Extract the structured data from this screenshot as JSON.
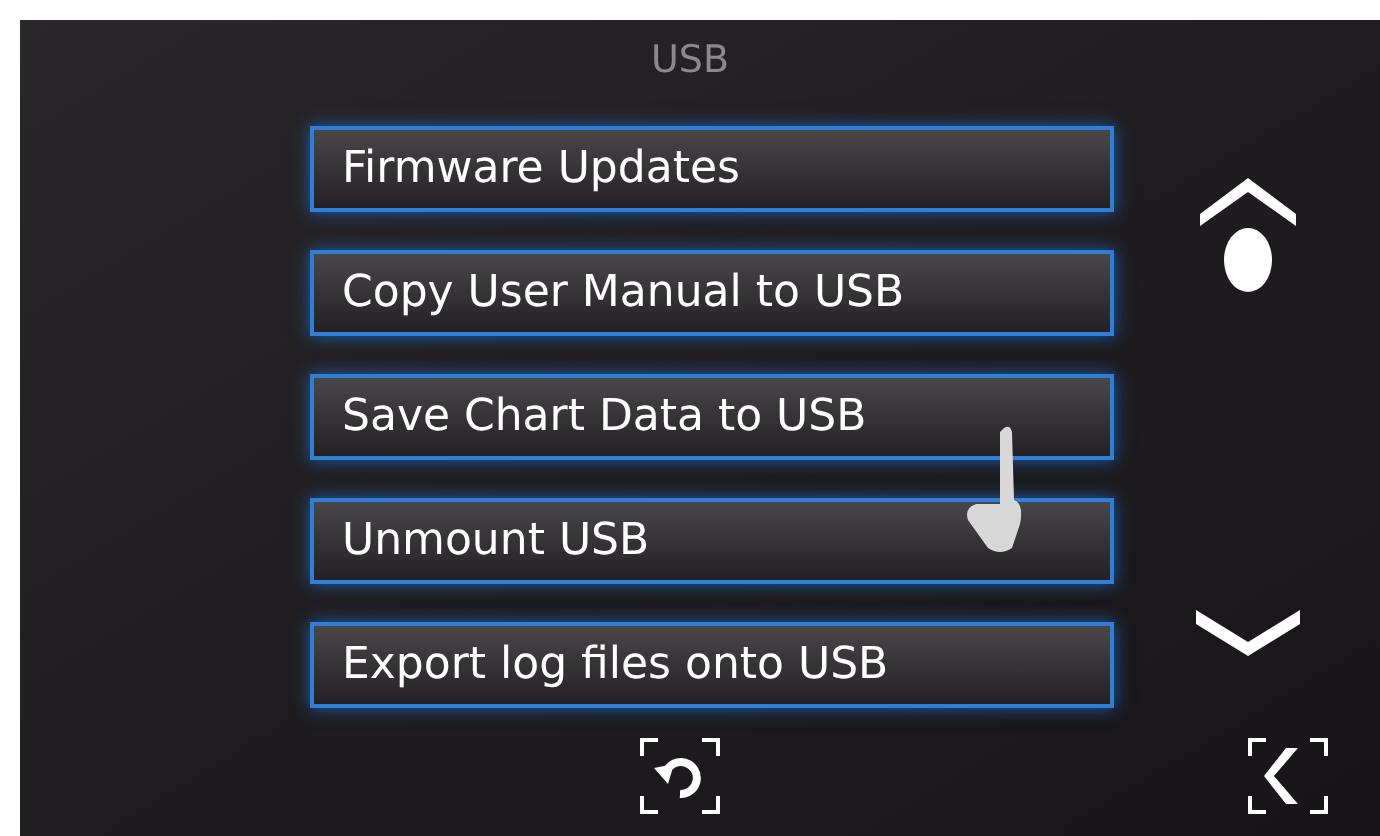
{
  "title": "USB",
  "menu": [
    {
      "label": "Firmware Updates"
    },
    {
      "label": "Copy User Manual to USB"
    },
    {
      "label": "Save Chart Data to USB"
    },
    {
      "label": "Unmount USB"
    },
    {
      "label": "Export log files onto USB"
    }
  ]
}
